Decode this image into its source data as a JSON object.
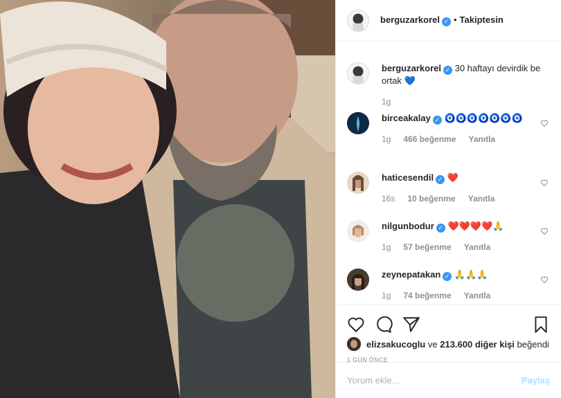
{
  "post": {
    "author": "berguzarkorel",
    "follow_status": "Takiptesin",
    "caption_user": "berguzarkorel",
    "caption_text": "30 haftayı devirdik be ortak 💙",
    "caption_age": "1g"
  },
  "comments": [
    {
      "user": "birceakalay",
      "text": "🧿🧿🧿🧿🧿🧿🧿",
      "age": "1g",
      "likes": "466 beğenme",
      "reply": "Yanıtla"
    },
    {
      "user": "haticesendil",
      "text": "❤️",
      "age": "16s",
      "likes": "10 beğenme",
      "reply": "Yanıtla"
    },
    {
      "user": "nilgunbodur",
      "text": "❤️❤️❤️❤️🙏",
      "age": "1g",
      "likes": "57 beğenme",
      "reply": "Yanıtla"
    },
    {
      "user": "zeynepatakan",
      "text": "🙏🙏🙏",
      "age": "1g",
      "likes": "74 beğenme",
      "reply": "Yanıtla"
    }
  ],
  "likes_line": {
    "user": "elizsakucoglu",
    "connector": "ve",
    "count": "213.600 diğer kişi",
    "suffix": "beğendi"
  },
  "timestamp": "1 GÜN ÖNCE",
  "comment_box": {
    "placeholder": "Yorum ekle...",
    "post_label": "Paylaş"
  },
  "icons": [
    "heart-icon",
    "comment-icon",
    "share-icon",
    "bookmark-icon"
  ],
  "colors": {
    "verified": "#3897f0",
    "like_red": "#ed4956",
    "post_disabled": "#b2dffc"
  }
}
